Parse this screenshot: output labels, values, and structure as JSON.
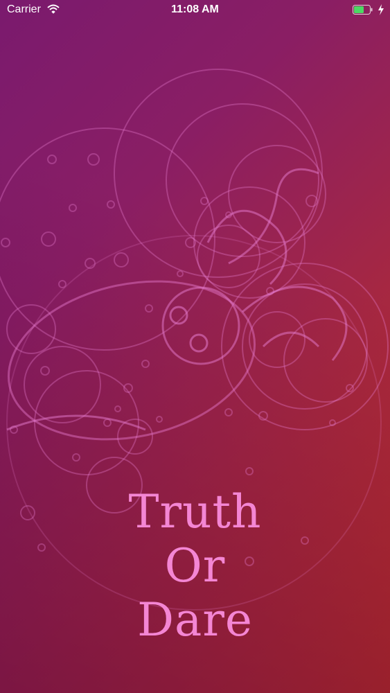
{
  "status_bar": {
    "carrier": "Carrier",
    "time": "11:08 AM",
    "battery_color": "#4cd964"
  },
  "splash": {
    "title_lines": [
      "Truth",
      "Or",
      "Dare"
    ],
    "title_color": "#f486d4"
  },
  "background": {
    "gradient_colors": [
      "#7a1a6e",
      "#a8283f",
      "#c2301f"
    ],
    "line_art_color": "#e67bcf"
  }
}
